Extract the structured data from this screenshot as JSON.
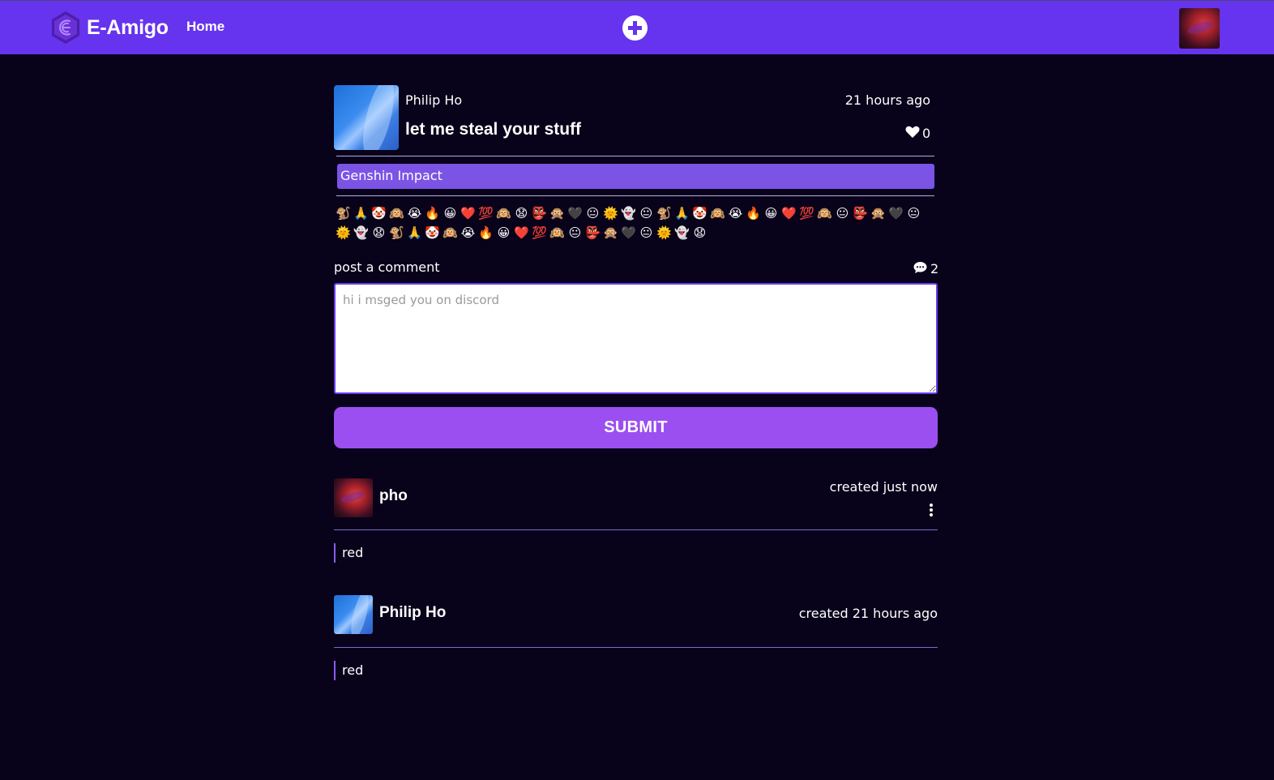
{
  "navbar": {
    "brand": "E-Amigo",
    "home_label": "Home",
    "add_icon": "plus-circle-icon",
    "brand_color": "#6633ee"
  },
  "post": {
    "author": "Philip Ho",
    "time": "21 hours ago",
    "title": "let me steal your stuff",
    "likes": "0",
    "tag": "Genshin Impact"
  },
  "reactions": [
    "🐒",
    "🙏",
    "🤡",
    "🙉",
    "😭",
    "🔥",
    "😀",
    "❤️",
    "💯",
    "🙉",
    "😧",
    "👺",
    "🙊",
    "🖤",
    "😐",
    "🌞",
    "👻",
    "😐",
    "🐒",
    "🙏",
    "🤡",
    "🙉",
    "😭",
    "🔥",
    "😀",
    "❤️",
    "💯",
    "🙉",
    "😐",
    "👺",
    "🙊",
    "🖤",
    "😐",
    "🌞",
    "👻",
    "😧",
    "🐒",
    "🙏",
    "🤡",
    "🙉",
    "😭",
    "🔥",
    "😀",
    "❤️",
    "💯",
    "🙉",
    "😐",
    "👺",
    "🙊",
    "🖤",
    "😐",
    "🌞",
    "👻",
    "😧"
  ],
  "comment_form": {
    "label": "post a comment",
    "count": "2",
    "placeholder": "hi i msged you on discord",
    "submit_label": "SUBMIT"
  },
  "comments": [
    {
      "author": "pho",
      "time": "created just now",
      "body": "red"
    },
    {
      "author": "Philip Ho",
      "time": "created 21 hours ago",
      "body": "red"
    }
  ]
}
